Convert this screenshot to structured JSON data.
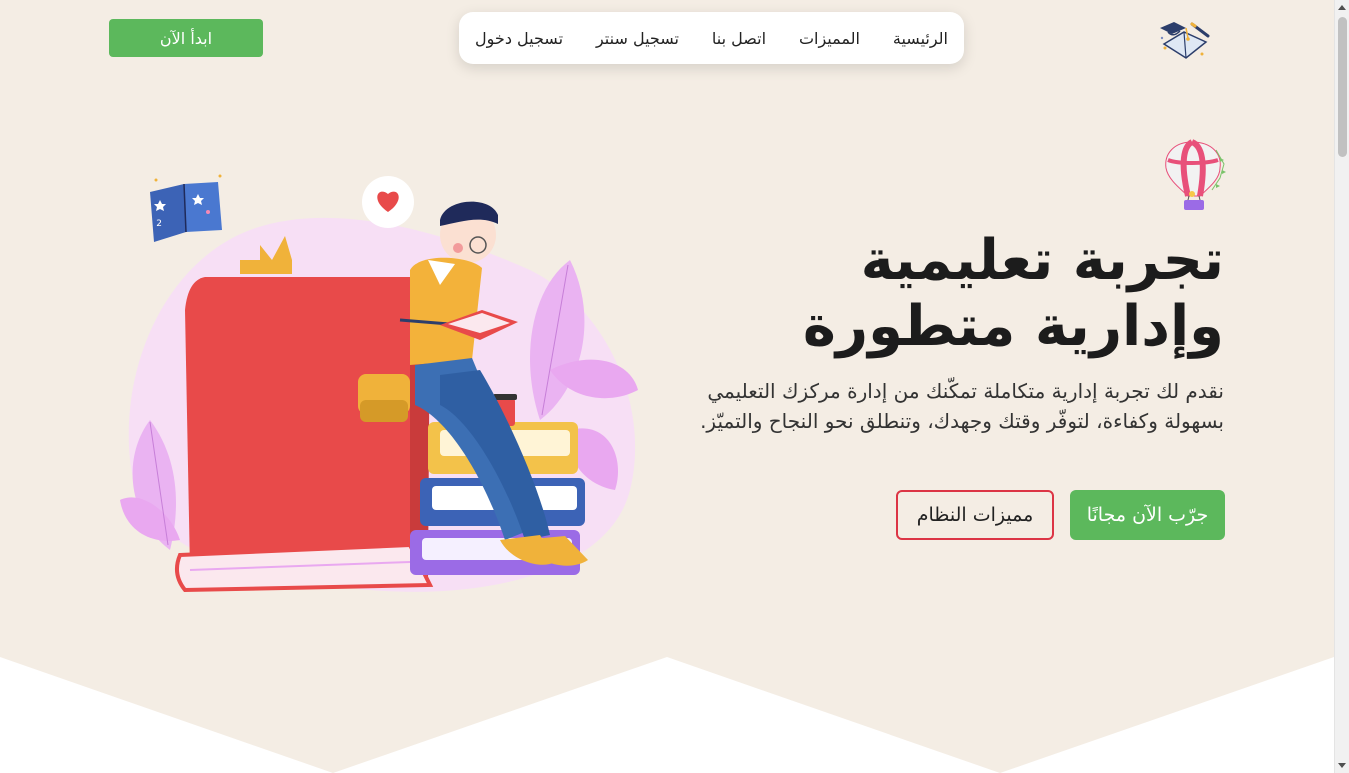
{
  "header": {
    "start_button": "ابدأ الآن",
    "logo_icon": "graduation-book-logo-icon"
  },
  "nav": {
    "items": [
      {
        "label": "الرئيسية"
      },
      {
        "label": "المميزات"
      },
      {
        "label": "اتصل بنا"
      },
      {
        "label": "تسجيل سنتر"
      },
      {
        "label": "تسجيل دخول"
      }
    ]
  },
  "hero": {
    "title_line1": "تجربة تعليمية",
    "title_line2": "وإدارية متطورة",
    "description": "نقدم لك تجربة إدارية متكاملة تمكّنك من إدارة مركزك التعليمي بسهولة وكفاءة، لتوفّر وقتك وجهدك، وتنطلق نحو النجاح والتميّز.",
    "cta_primary": "جرّب الآن مجانًا",
    "cta_secondary": "مميزات النظام"
  },
  "colors": {
    "background": "#f4ede4",
    "accent_green": "#5cb85c",
    "accent_red": "#dc3545",
    "book_red": "#e84a4a",
    "blob_pink": "#f7dff5"
  },
  "icons": {
    "illustration": "student-reading-on-books-illustration",
    "balloon": "hot-air-balloon-icon",
    "star_book": "star-book-icon",
    "heart": "heart-bubble-icon"
  }
}
